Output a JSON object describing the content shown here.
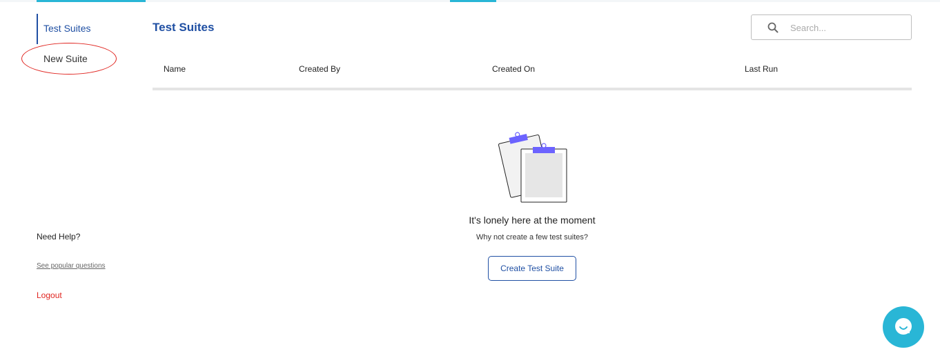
{
  "colors": {
    "accent": "#1f4fa3",
    "top_bar": "#29b6d6",
    "danger": "#e0241f",
    "chat": "#29b6d6"
  },
  "sidebar": {
    "items": [
      {
        "label": "Test Suites",
        "active": true
      },
      {
        "label": "New Suite",
        "active": false,
        "highlighted": true
      }
    ],
    "help_title": "Need Help?",
    "help_link": "See popular questions",
    "logout": "Logout"
  },
  "main": {
    "title": "Test Suites",
    "search": {
      "placeholder": "Search...",
      "value": "",
      "icon": "search-icon"
    },
    "table": {
      "columns": [
        "Name",
        "Created By",
        "Created On",
        "Last Run"
      ],
      "rows": []
    },
    "empty_state": {
      "icon": "clipboard-icon",
      "title": "It's lonely here at the moment",
      "subtitle": "Why not create a few test suites?",
      "button": "Create Test Suite"
    }
  },
  "chat": {
    "icon": "chat-bubble-icon"
  }
}
